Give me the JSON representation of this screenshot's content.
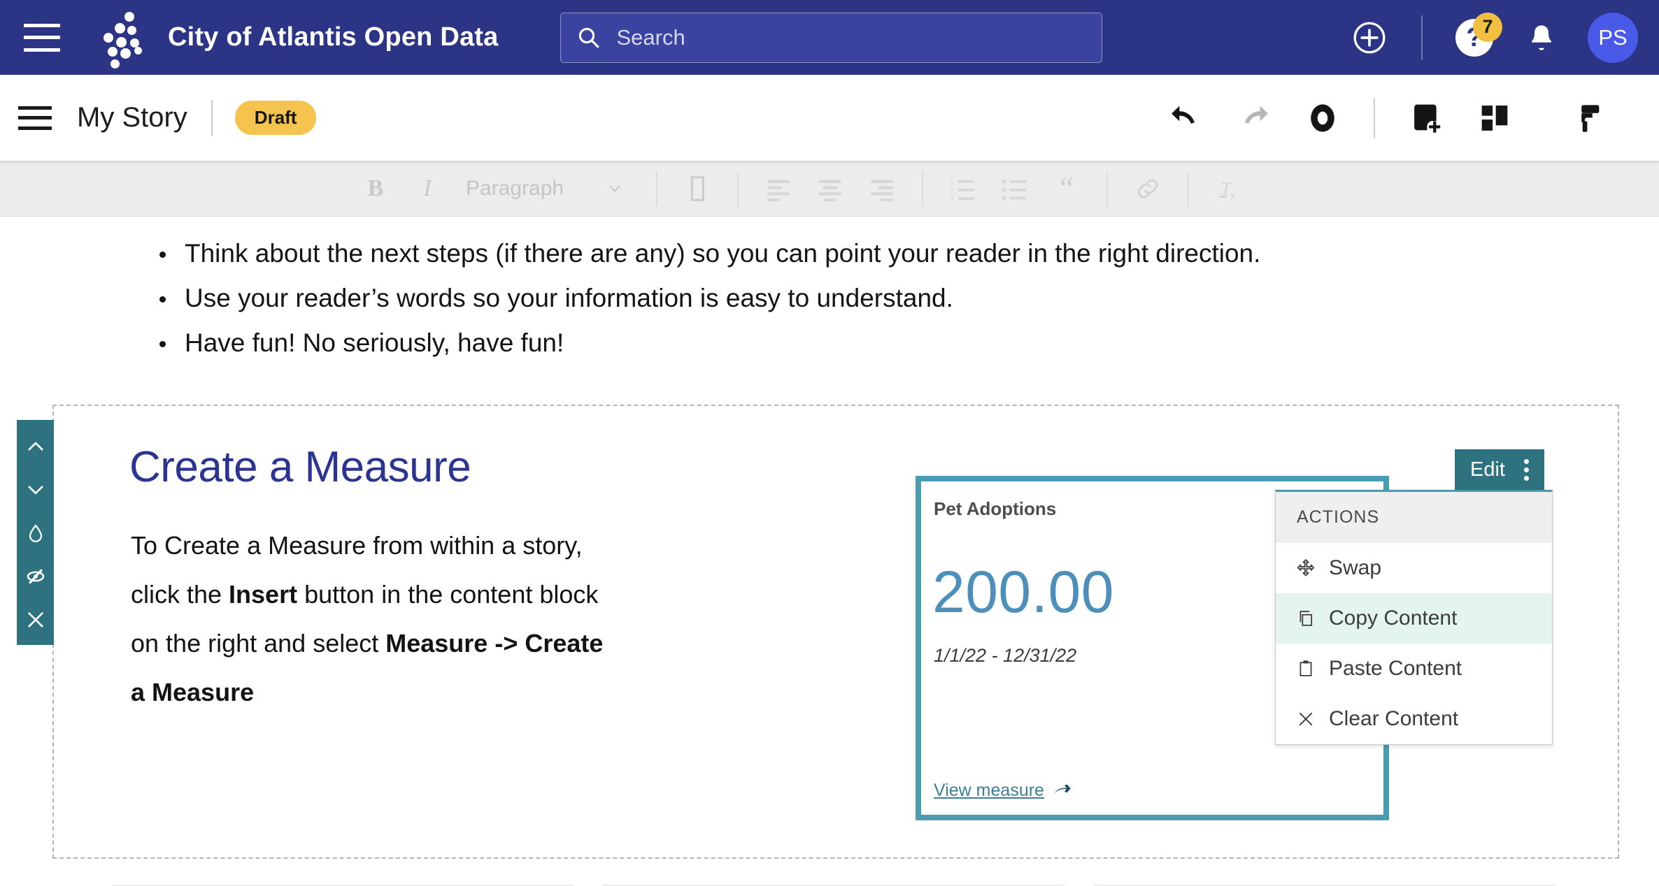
{
  "global_header": {
    "menu_icon": "hamburger-icon",
    "logo_icon": "socrata-dots-logo",
    "site_title": "City of Atlantis Open Data",
    "search": {
      "placeholder": "Search",
      "value": "",
      "icon": "search-icon"
    },
    "create_icon": "plus-circle-icon",
    "help": {
      "icon": "question-mark-icon",
      "badge_count": "7"
    },
    "notifications_icon": "bell-icon",
    "avatar_initials": "PS"
  },
  "story_bar": {
    "menu_icon": "hamburger-icon",
    "title": "My Story",
    "status_badge": "Draft",
    "tools": [
      {
        "name": "undo-button",
        "icon": "undo-arrow-icon"
      },
      {
        "name": "redo-button",
        "icon": "redo-arrow-icon"
      },
      {
        "name": "preview-button",
        "icon": "eye-icon"
      },
      {
        "name": "insert-block-button",
        "icon": "add-block-icon"
      },
      {
        "name": "layout-button",
        "icon": "grid-layout-icon"
      },
      {
        "name": "theme-button",
        "icon": "paint-roller-icon"
      }
    ]
  },
  "format_bar": {
    "bold_label": "B",
    "italic_label": "I",
    "paragraph_label": "Paragraph",
    "chevron_icon": "chevron-down-icon",
    "buttons": [
      "text-color-icon",
      "align-left-icon",
      "align-center-icon",
      "align-right-icon",
      "ordered-list-icon",
      "unordered-list-icon",
      "blockquote-icon",
      "link-icon",
      "clear-formatting-icon"
    ]
  },
  "content": {
    "clipped_line": "",
    "bullets": [
      "Think about the next steps (if there are any) so you can point your reader in the right direction.",
      "Use your reader’s words so your information is easy to understand.",
      "Have fun! No seriously, have fun!"
    ]
  },
  "block": {
    "side_toolbar": [
      {
        "name": "move-block-up-button",
        "icon": "chevron-up-icon"
      },
      {
        "name": "move-block-down-button",
        "icon": "chevron-down-icon"
      },
      {
        "name": "block-theme-button",
        "icon": "water-drop-icon"
      },
      {
        "name": "hide-block-button",
        "icon": "eye-slash-icon"
      },
      {
        "name": "delete-block-button",
        "icon": "close-x-icon"
      }
    ],
    "heading": "Create a Measure",
    "paragraph": {
      "part1": "To Create a Measure from within a story, click the ",
      "bold1": "Insert",
      "part2": " button in the content block on the right and select ",
      "bold2": "Measure -> Create a Measure"
    }
  },
  "measure_card": {
    "title": "Pet Adoptions",
    "value": "200.00",
    "date_range": "1/1/22 - 12/31/22",
    "link_label": "View measure",
    "link_icon": "arrow-right-icon",
    "border_color": "#4a9db0"
  },
  "edit_tab": {
    "label": "Edit",
    "kebab_icon": "kebab-menu-icon",
    "background_color": "#2e7280"
  },
  "actions_menu": {
    "header": "ACTIONS",
    "items": [
      {
        "label": "Swap",
        "icon": "move-arrows-icon",
        "highlighted": false
      },
      {
        "label": "Copy Content",
        "icon": "copy-icon",
        "highlighted": true
      },
      {
        "label": "Paste Content",
        "icon": "clipboard-icon",
        "highlighted": false
      },
      {
        "label": "Clear Content",
        "icon": "close-x-icon",
        "highlighted": false
      }
    ]
  },
  "colors": {
    "header_blue": "#2c3585",
    "teal": "#2e7280",
    "card_teal": "#4a9db0",
    "heading_blue": "#2b3591",
    "draft_yellow": "#f5c44e",
    "value_blue": "#4c8fba"
  }
}
